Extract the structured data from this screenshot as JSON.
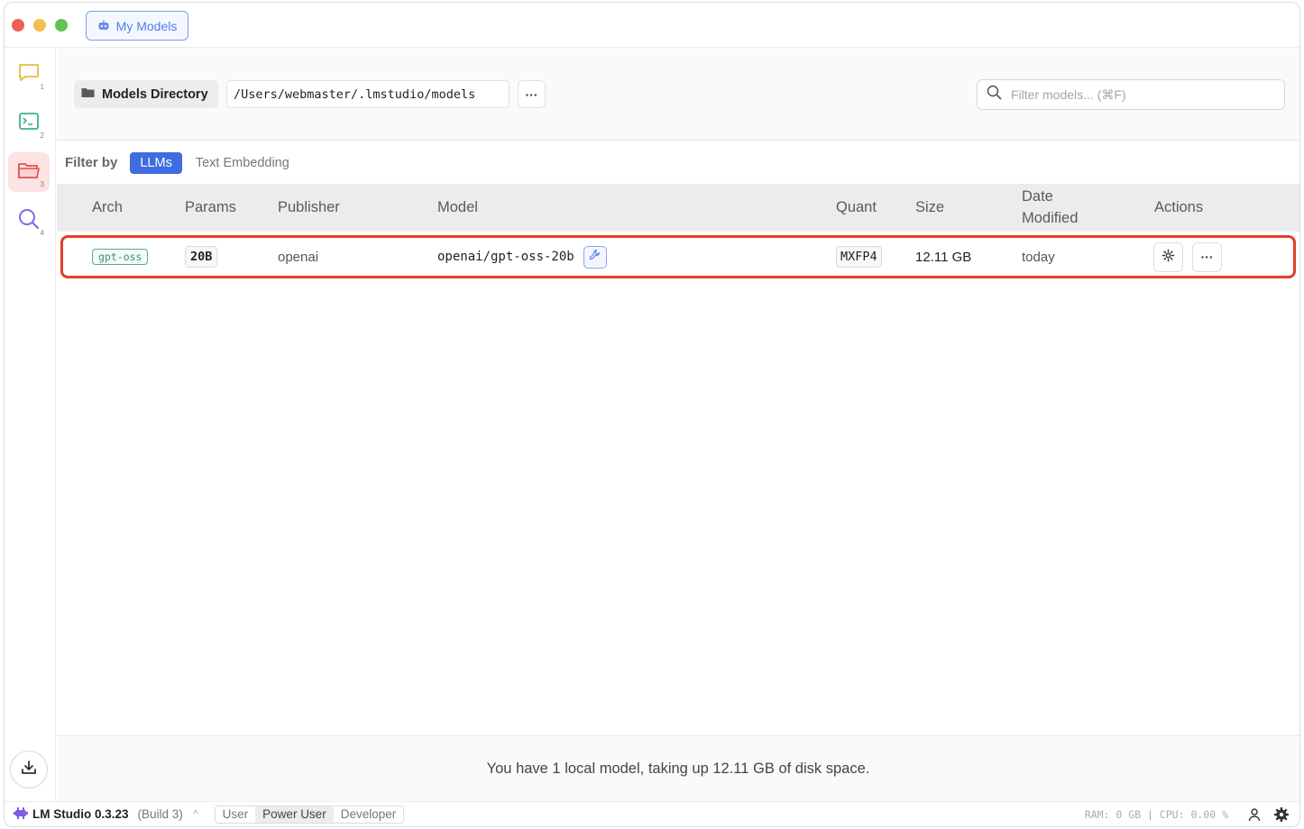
{
  "titlebar": {
    "tab_label": "My Models"
  },
  "sidebar": {
    "items": [
      {
        "icon": "chat-icon",
        "num": "1",
        "color": "#e8b93c"
      },
      {
        "icon": "terminal-icon",
        "num": "2",
        "color": "#3fb08a"
      },
      {
        "icon": "folder-icon",
        "num": "3",
        "color": "#e0504a"
      },
      {
        "icon": "search-icon",
        "num": "4",
        "color": "#7d6fe0"
      }
    ],
    "download_icon": "download-icon"
  },
  "toolbar": {
    "directory_label": "Models Directory",
    "directory_path": "/Users/webmaster/.lmstudio/models",
    "more_label": "···",
    "filter_placeholder": "Filter models... (⌘F)"
  },
  "filter": {
    "label": "Filter by",
    "options": [
      "LLMs",
      "Text Embedding"
    ],
    "selected": "LLMs"
  },
  "table": {
    "columns": [
      "Arch",
      "Params",
      "Publisher",
      "Model",
      "Quant",
      "Size",
      "Date Modified",
      "Actions"
    ],
    "columns_date_line1": "Date",
    "columns_date_line2": "Modified",
    "rows": [
      {
        "arch": "gpt-oss",
        "params": "20B",
        "publisher": "openai",
        "model": "openai/gpt-oss-20b",
        "quant": "MXFP4",
        "size": "12.11 GB",
        "date_modified": "today",
        "more_label": "···"
      }
    ]
  },
  "summary": "You have 1 local model, taking up 12.11 GB of disk space.",
  "statusbar": {
    "app_name": "LM Studio 0.3.23",
    "build": "(Build 3)",
    "modes": [
      "User",
      "Power User",
      "Developer"
    ],
    "active_mode": "Power User",
    "stats": "RAM: 0 GB  |  CPU: 0.00 %"
  },
  "colors": {
    "accent": "#3f6ce0",
    "highlight_border": "#e0402e"
  }
}
